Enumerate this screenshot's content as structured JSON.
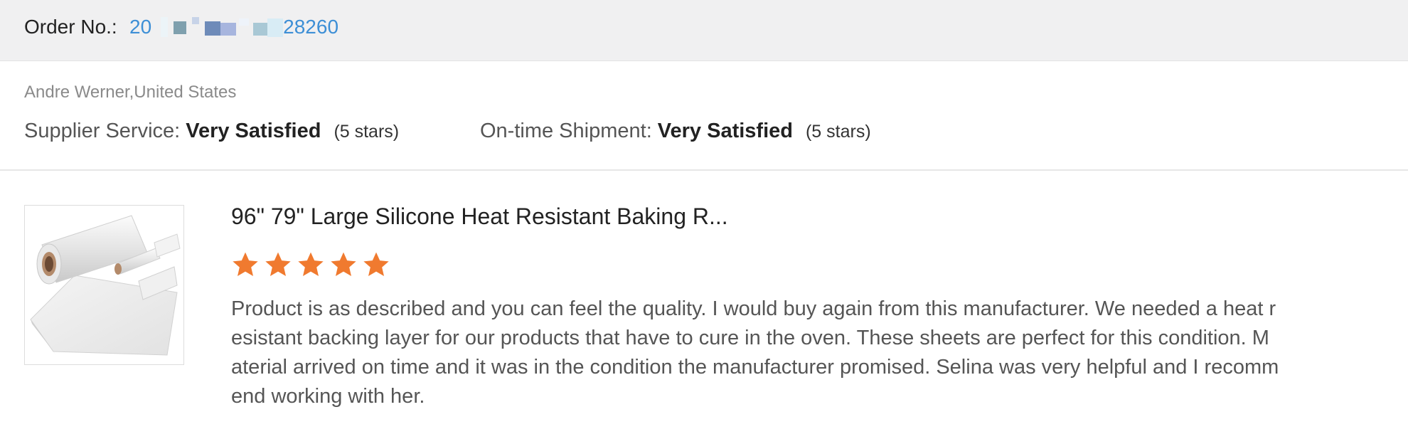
{
  "order": {
    "label": "Order No.:",
    "number_visible_prefix": "20",
    "number_visible_suffix": "28260"
  },
  "buyer": {
    "name_country": "Andre Werner,United States"
  },
  "ratings": {
    "supplier_service": {
      "label": "Supplier Service:",
      "value": "Very Satisfied",
      "stars_text": "(5 stars)"
    },
    "ontime_shipment": {
      "label": "On-time Shipment:",
      "value": "Very Satisfied",
      "stars_text": "(5 stars)"
    }
  },
  "review": {
    "product_title": "96\" 79\" Large Silicone Heat Resistant Baking R...",
    "star_rating": 5,
    "star_max": 5,
    "text": "Product is as described and you can feel the quality. I would buy again from this manufacturer. We needed a heat resistant backing layer for our products that have to cure in the oven. These sheets are perfect for this condition. Material arrived on time and it was in the condition the manufacturer promised. Selina was very helpful and I recommend working with her."
  },
  "colors": {
    "header_bg": "#f0f0f1",
    "order_link": "#3d8fd6",
    "star": "#f07a2f",
    "redaction_blocks": [
      "#7fa0ae",
      "#6e8bb9",
      "#a7b5de",
      "#a9c8d5",
      "#d8ecf5"
    ]
  },
  "icons": {
    "rating_star": "star-icon",
    "product_image": "silicone-sheet-roll-image"
  }
}
